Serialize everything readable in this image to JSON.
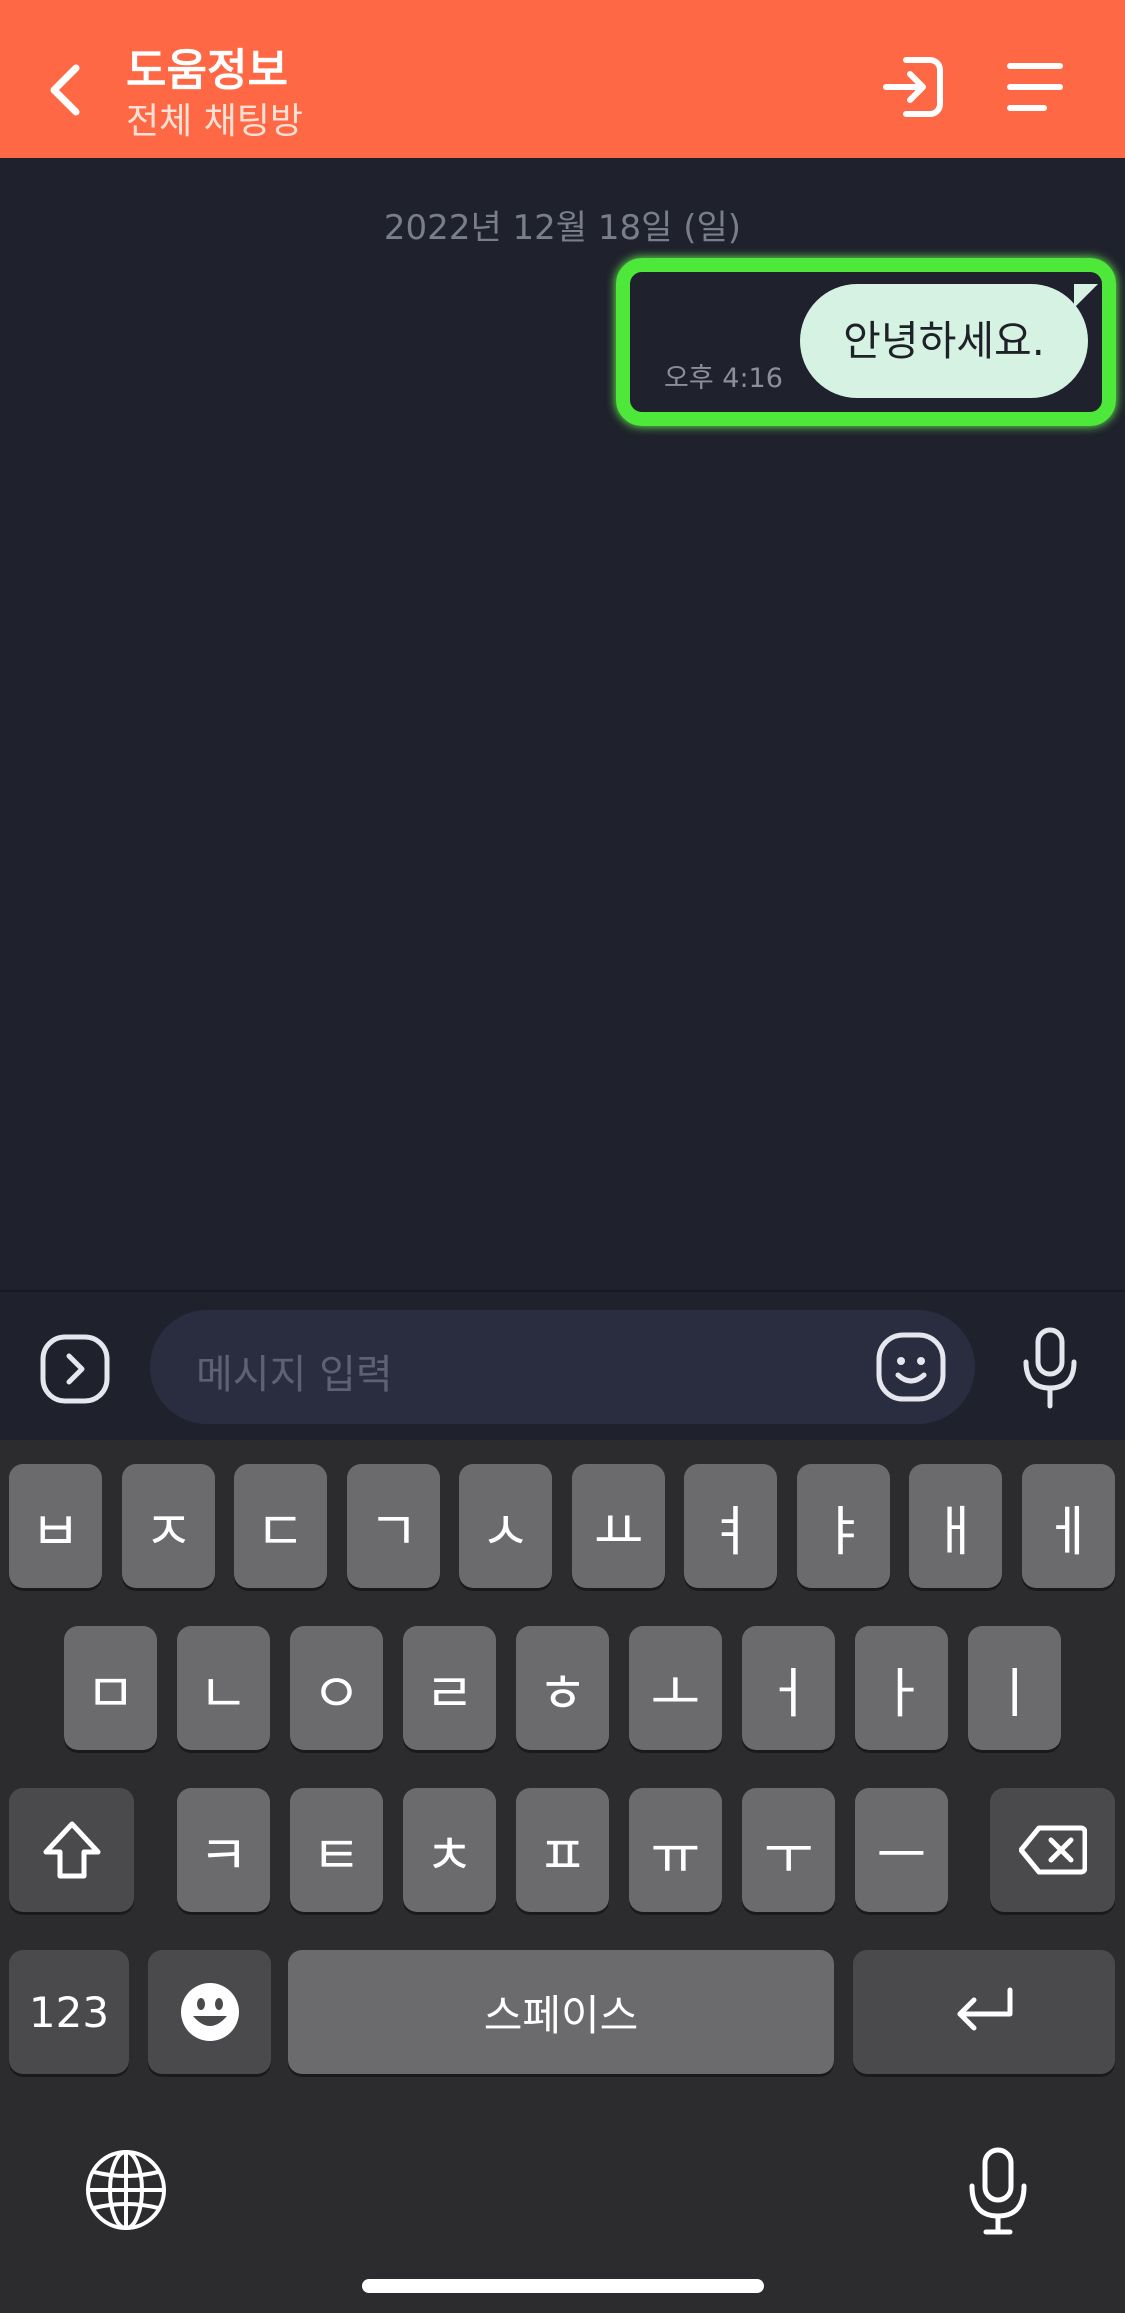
{
  "header": {
    "title": "도움정보",
    "subtitle": "전체 채팅방",
    "color": "#ff6845"
  },
  "chat": {
    "date_separator": "2022년 12월 18일 (일)",
    "messages": [
      {
        "text": "안녕하세요.",
        "time": "오후 4:16",
        "sender": "me"
      }
    ],
    "highlight_color": "#4ee83a"
  },
  "input": {
    "placeholder": "메시지 입력"
  },
  "keyboard": {
    "row1": [
      "ㅂ",
      "ㅈ",
      "ㄷ",
      "ㄱ",
      "ㅅ",
      "ㅛ",
      "ㅕ",
      "ㅑ",
      "ㅐ",
      "ㅔ"
    ],
    "row2": [
      "ㅁ",
      "ㄴ",
      "ㅇ",
      "ㄹ",
      "ㅎ",
      "ㅗ",
      "ㅓ",
      "ㅏ",
      "ㅣ"
    ],
    "row3": [
      "ㅋ",
      "ㅌ",
      "ㅊ",
      "ㅍ",
      "ㅠ",
      "ㅜ",
      "ㅡ"
    ],
    "numbers_label": "123",
    "space_label": "스페이스"
  },
  "icons": {
    "back": "chevron-left-icon",
    "enter": "login-icon",
    "menu": "hamburger-menu-icon",
    "expand": "chevron-right-box-icon",
    "emoji": "smiley-icon",
    "mic": "microphone-icon",
    "shift": "shift-arrow-icon",
    "backspace": "backspace-icon",
    "return": "return-arrow-icon",
    "globe": "globe-icon"
  }
}
